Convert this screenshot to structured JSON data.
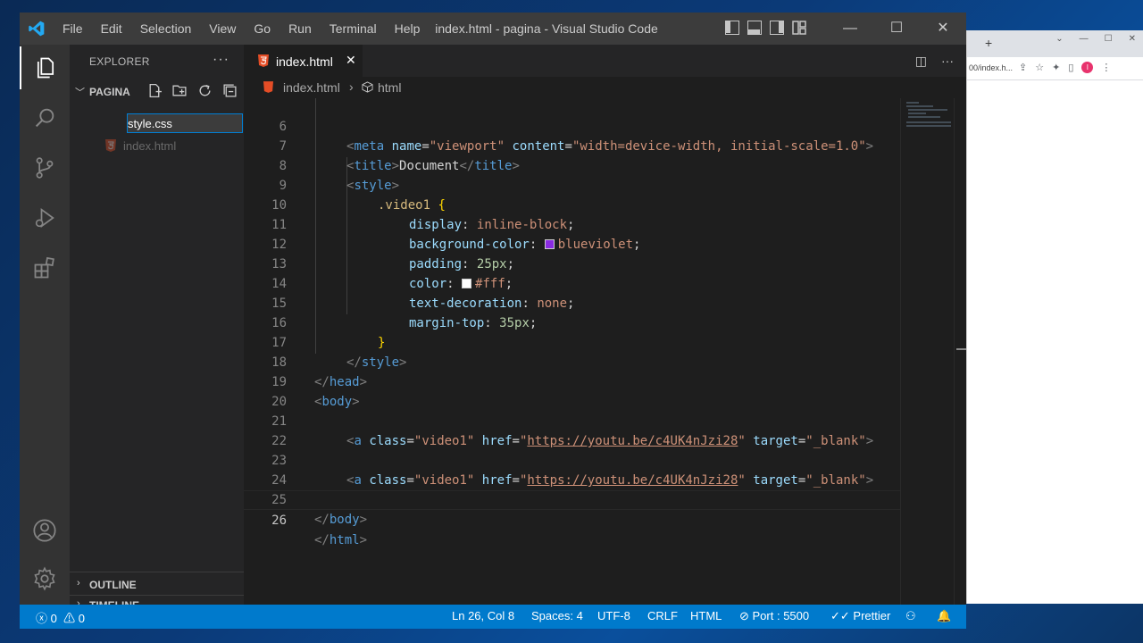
{
  "window": {
    "title": "index.html - pagina - Visual Studio Code",
    "menu": [
      "File",
      "Edit",
      "Selection",
      "View",
      "Go",
      "Run",
      "Terminal",
      "Help"
    ]
  },
  "colors": {
    "accent": "#007acc",
    "titlebar": "#3c3c3c",
    "editor_bg": "#1e1e1e",
    "sidebar_bg": "#252526",
    "html_icon": "#e44d26"
  },
  "activity_icons": [
    "files-icon",
    "search-icon",
    "source-control-icon",
    "run-debug-icon",
    "extensions-icon",
    "account-icon",
    "settings-gear-icon"
  ],
  "sidebar": {
    "title": "EXPLORER",
    "more": "···",
    "folder": "PAGINA",
    "new_file_value": "style.css",
    "files": [
      {
        "name": "index.html"
      }
    ],
    "sections": [
      "OUTLINE",
      "TIMELINE"
    ]
  },
  "tabs": [
    {
      "label": "index.html",
      "close": "✕"
    }
  ],
  "breadcrumb": {
    "file": "index.html",
    "separator": "›",
    "symbol": "html"
  },
  "editor": {
    "current_line": 26,
    "line_numbers": [
      "6",
      "7",
      "8",
      "9",
      "10",
      "11",
      "12",
      "13",
      "14",
      "15",
      "16",
      "17",
      "18",
      "19",
      "20",
      "21",
      "22",
      "23",
      "24",
      "25",
      "26"
    ],
    "lines": {
      "l6": {
        "lt": "<",
        "tag": "meta",
        "a1": "name",
        "eq1": "=",
        "v1": "\"viewport\"",
        "a2": "content",
        "eq2": "=",
        "v2": "\"width=device-width, initial-scale=1.0\"",
        "gt": ">"
      },
      "l7": {
        "open": "<",
        "tag": "title",
        "close": ">",
        "text": "Document",
        "open2": "</",
        "tag2": "title",
        "close2": ">"
      },
      "l8": {
        "open": "<",
        "tag": "style",
        "close": ">"
      },
      "l9": {
        "sel": ".video1",
        "brace": "{"
      },
      "l10": {
        "prop": "display",
        "colon": ":",
        "val": "inline-block",
        "semi": ";"
      },
      "l11": {
        "prop": "background-color",
        "colon": ":",
        "val": "blueviolet",
        "semi": ";",
        "swatch": "#8a2be2"
      },
      "l12": {
        "prop": "padding",
        "colon": ":",
        "val": "25px",
        "semi": ";"
      },
      "l13": {
        "prop": "color",
        "colon": ":",
        "val": "#fff",
        "semi": ";",
        "swatch": "#ffffff"
      },
      "l14": {
        "prop": "text-decoration",
        "colon": ":",
        "val": "none",
        "semi": ";"
      },
      "l15": {
        "prop": "margin-top",
        "colon": ":",
        "val": "35px",
        "semi": ";"
      },
      "l16": {
        "brace": "}"
      },
      "l17": {
        "open": "</",
        "tag": "style",
        "close": ">"
      },
      "l18": {
        "open": "</",
        "tag": "head",
        "close": ">"
      },
      "l19": {
        "open": "<",
        "tag": "body",
        "close": ">"
      },
      "l21": {
        "open": "<",
        "tag": "a",
        "a1": "class",
        "eq1": "=",
        "v1": "\"video1\"",
        "a2": "href",
        "eq2": "=",
        "q1": "\"",
        "link": "https://youtu.be/c4UK4nJzi28",
        "q2": "\"",
        "a3": "target",
        "eq3": "=",
        "v3": "\"_blank\"",
        "gt": ">"
      },
      "l23": {
        "open": "<",
        "tag": "a",
        "a1": "class",
        "eq1": "=",
        "v1": "\"video1\"",
        "a2": "href",
        "eq2": "=",
        "q1": "\"",
        "link": "https://youtu.be/c4UK4nJzi28",
        "q2": "\"",
        "a3": "target",
        "eq3": "=",
        "v3": "\"_blank\"",
        "gt": ">"
      },
      "l25": {
        "open": "</",
        "tag": "body",
        "close": ">"
      },
      "l26": {
        "open": "</",
        "tag": "html",
        "close": ">"
      }
    }
  },
  "statusbar": {
    "errors": "0",
    "warnings": "0",
    "position": "Ln 26, Col 8",
    "spaces": "Spaces: 4",
    "encoding": "UTF-8",
    "eol": "CRLF",
    "language": "HTML",
    "port": "Port : 5500",
    "prettier": "Prettier"
  },
  "browser": {
    "new_tab": "+",
    "url": "00/index.h...",
    "avatar": "I"
  }
}
